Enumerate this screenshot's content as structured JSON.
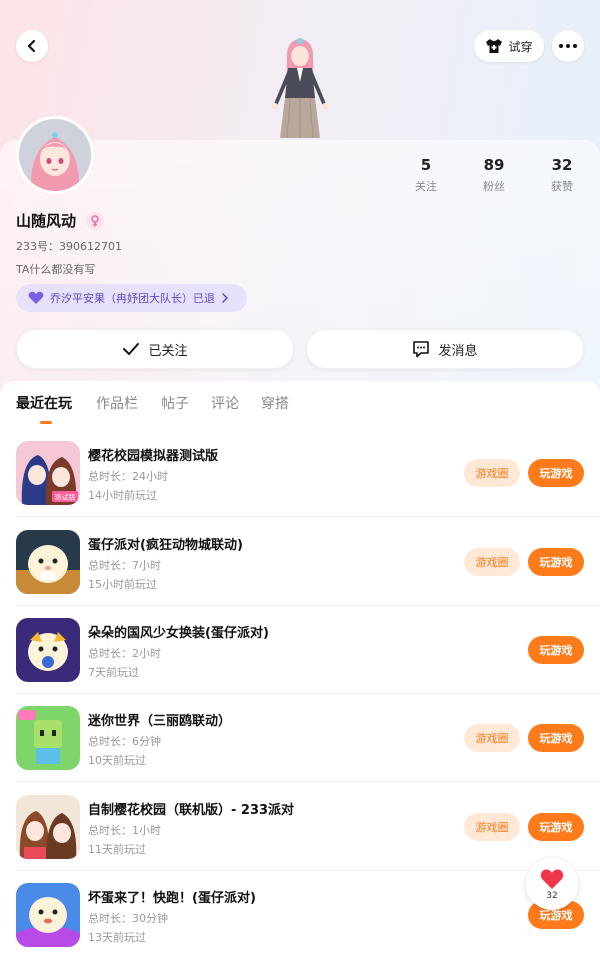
{
  "header": {
    "tryon_label": "试穿",
    "icons": [
      "back-icon",
      "shirt-icon",
      "more-icon"
    ]
  },
  "profile": {
    "username": "山随风动",
    "uid": "233号：390612701",
    "bio": "TA什么都没有写",
    "fan_badge": "乔汐平安果（冉妤团大队长）已退",
    "stats": [
      {
        "value": "5",
        "label": "关注"
      },
      {
        "value": "89",
        "label": "粉丝"
      },
      {
        "value": "32",
        "label": "获赞"
      }
    ],
    "follow_label": "已关注",
    "message_label": "发消息"
  },
  "tabs": [
    "最近在玩",
    "作品栏",
    "帖子",
    "评论",
    "穿搭"
  ],
  "games": [
    {
      "name": "樱花校园模拟器测试版",
      "duration": "总时长：24小时",
      "last_played": "14小时前玩过",
      "has_circle": true
    },
    {
      "name": "蛋仔派对(疯狂动物城联动)",
      "duration": "总时长：7小时",
      "last_played": "15小时前玩过",
      "has_circle": true
    },
    {
      "name": "朵朵的国风少女换装(蛋仔派对)",
      "duration": "总时长：2小时",
      "last_played": "7天前玩过",
      "has_circle": false
    },
    {
      "name": "迷你世界（三丽鸥联动）",
      "duration": "总时长：6分钟",
      "last_played": "10天前玩过",
      "has_circle": true
    },
    {
      "name": "自制樱花校园（联机版）- 233派对",
      "duration": "总时长：1小时",
      "last_played": "11天前玩过",
      "has_circle": true
    },
    {
      "name": "坏蛋来了！快跑！(蛋仔派对)",
      "duration": "总时长：30分钟",
      "last_played": "13天前玩过",
      "has_circle": false
    }
  ],
  "game_buttons": {
    "circle_label": "游戏圈",
    "play_label": "玩游戏"
  },
  "like_float": {
    "count": "32"
  },
  "colors": {
    "accent": "#ff7a1a",
    "badge_purple": "#5e49c9",
    "badge_bg": "#e7e1fb"
  }
}
